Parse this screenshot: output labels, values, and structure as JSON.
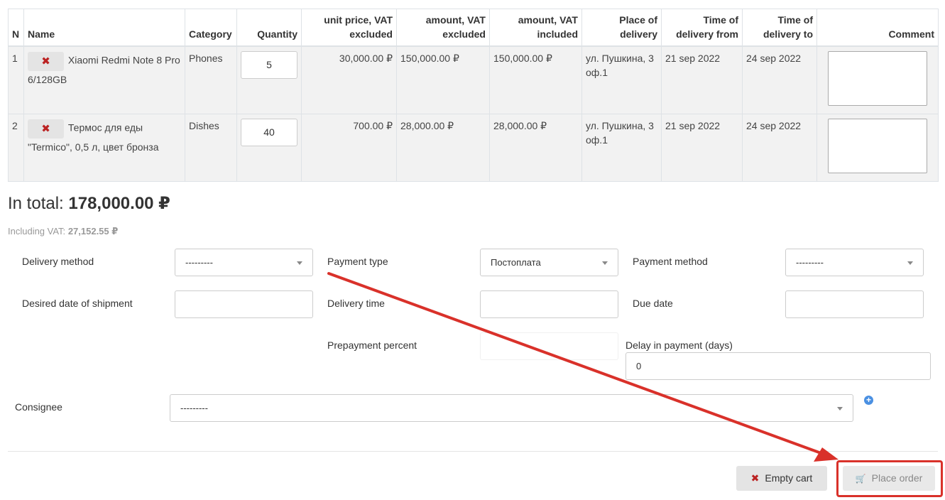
{
  "table": {
    "headers": {
      "n": "N",
      "name": "Name",
      "category": "Category",
      "quantity": "Quantity",
      "unit_price": "unit price, VAT excluded",
      "amount_ex": "amount, VAT excluded",
      "amount_inc": "amount, VAT included",
      "place": "Place of delivery",
      "time_from": "Time of delivery from",
      "time_to": "Time of delivery to",
      "comment": "Comment"
    },
    "rows": [
      {
        "n": "1",
        "name": "Xiaomi Redmi Note 8 Pro 6/128GB",
        "category": "Phones",
        "quantity": "5",
        "unit_price": "30,000.00 ₽",
        "amount_ex": "150,000.00 ₽",
        "amount_inc": "150,000.00 ₽",
        "place": "ул. Пушкина, 3 оф.1",
        "time_from": "21 sep 2022",
        "time_to": "24 sep 2022",
        "comment": ""
      },
      {
        "n": "2",
        "name": "Термос для еды \"Termico\", 0,5 л, цвет бронза",
        "category": "Dishes",
        "quantity": "40",
        "unit_price": "700.00 ₽",
        "amount_ex": "28,000.00 ₽",
        "amount_inc": "28,000.00 ₽",
        "place": "ул. Пушкина, 3 оф.1",
        "time_from": "21 sep 2022",
        "time_to": "24 sep 2022",
        "comment": ""
      }
    ]
  },
  "totals": {
    "label": "In total:",
    "amount": "178,000.00 ₽",
    "vat_label": "Including VAT:",
    "vat_amount": "27,152.55 ₽"
  },
  "form": {
    "delivery_method": {
      "label": "Delivery method",
      "value": "---------"
    },
    "payment_type": {
      "label": "Payment type",
      "value": "Постоплата"
    },
    "payment_method": {
      "label": "Payment method",
      "value": "---------"
    },
    "desired_date": {
      "label": "Desired date of shipment",
      "value": ""
    },
    "delivery_time": {
      "label": "Delivery time",
      "value": ""
    },
    "due_date": {
      "label": "Due date",
      "value": ""
    },
    "prepayment_percent": {
      "label": "Prepayment percent",
      "value": ""
    },
    "delay_in_payment": {
      "label": "Delay in payment (days)",
      "value": "0"
    },
    "consignee": {
      "label": "Consignee",
      "value": "---------"
    }
  },
  "buttons": {
    "empty_cart": "Empty cart",
    "place_order": "Place order"
  },
  "colors": {
    "annotation_red": "#d9312a",
    "remove_x": "#bb2222",
    "add_icon_blue": "#4a90e2"
  },
  "icons": {
    "remove_item": "close-icon",
    "add_consignee": "plus-circle-icon",
    "empty_cart": "close-icon",
    "place_order": "cart-icon"
  }
}
